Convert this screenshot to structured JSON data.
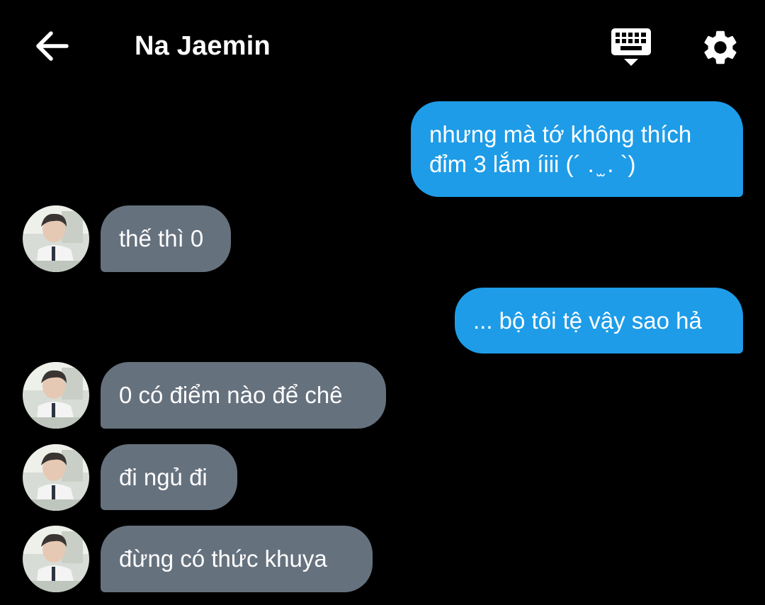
{
  "header": {
    "title": "Na Jaemin",
    "back_icon": "arrow-left-icon",
    "keyboard_icon": "keyboard-icon",
    "settings_icon": "gear-icon"
  },
  "colors": {
    "background": "#000000",
    "sent_bubble": "#1e9ce8",
    "received_bubble": "#66717e",
    "text": "#ffffff"
  },
  "messages": [
    {
      "direction": "sent",
      "lines": [
        "nhưng mà tớ không thích",
        "đỉm 3 lắm íiii (´ . ̫ . `)"
      ]
    },
    {
      "direction": "received",
      "lines": [
        "thế thì 0"
      ]
    },
    {
      "direction": "sent",
      "lines": [
        "... bộ tôi tệ vậy sao hả"
      ]
    },
    {
      "direction": "received",
      "lines": [
        "0 có điểm nào để chê"
      ]
    },
    {
      "direction": "received",
      "lines": [
        "đi ngủ đi"
      ]
    },
    {
      "direction": "received",
      "lines": [
        "đừng có thức khuya"
      ]
    }
  ]
}
